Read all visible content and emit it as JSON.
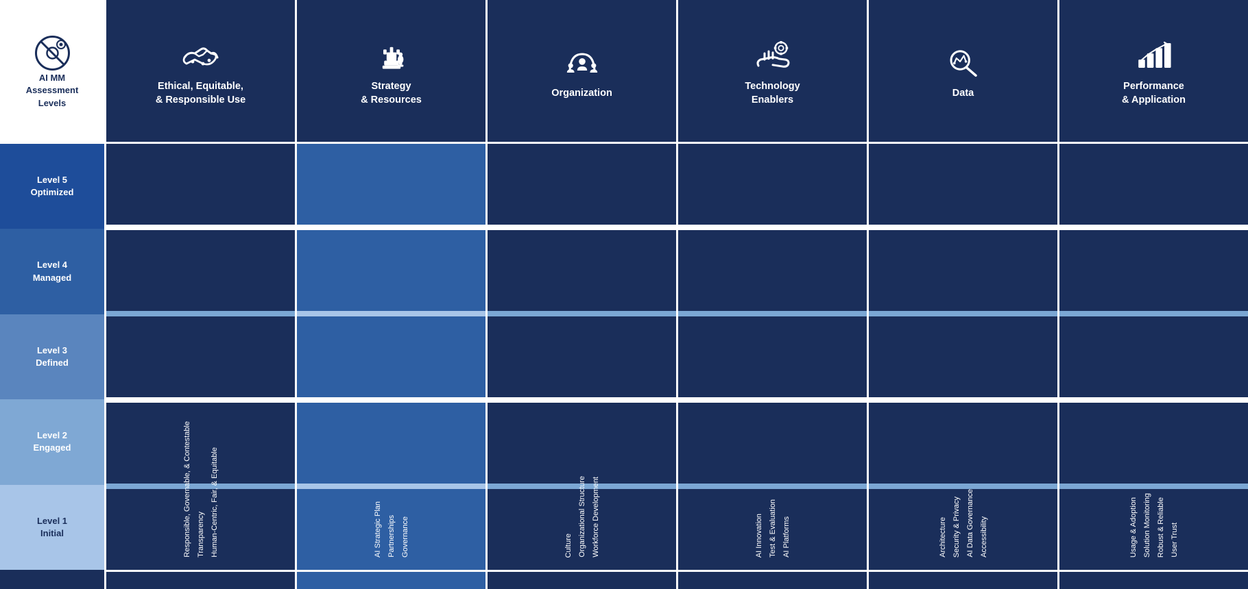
{
  "sidebar": {
    "logo_alt": "AI MM Logo",
    "title": "AI MM\nAssessment\nLevels",
    "levels": [
      {
        "id": "level5",
        "label": "Level 5\nOptimized",
        "color": "#1e4d9a"
      },
      {
        "id": "level4",
        "label": "Level 4\nManaged",
        "color": "#2e5fa3"
      },
      {
        "id": "level3",
        "label": "Level 3\nDefined",
        "color": "#5a85be"
      },
      {
        "id": "level2",
        "label": "Level 2\nEngaged",
        "color": "#7fa8d4"
      },
      {
        "id": "level1",
        "label": "Level 1\nInitial",
        "color": "#a8c5e8"
      }
    ]
  },
  "domains": [
    {
      "id": "ethical",
      "title": "Ethical, Equitable,\n& Responsible Use",
      "icon": "handshake",
      "items": [
        "Responsible, Governable, & Contestable",
        "Transparency",
        "Human-Centric, Fair, & Equitable"
      ],
      "col_shade": "dark"
    },
    {
      "id": "strategy",
      "title": "Strategy\n& Resources",
      "icon": "chess",
      "items": [
        "AI Strategic Plan",
        "Partnerships",
        "Governance"
      ],
      "col_shade": "light"
    },
    {
      "id": "organization",
      "title": "Organization",
      "icon": "org",
      "items": [
        "Culture",
        "Organizational Structure",
        "Workforce Development"
      ],
      "col_shade": "dark"
    },
    {
      "id": "technology",
      "title": "Technology\nEnablers",
      "icon": "gear-hand",
      "items": [
        "AI Innovation",
        "Test & Evaluation",
        "AI Platforms"
      ],
      "col_shade": "dark"
    },
    {
      "id": "data",
      "title": "Data",
      "icon": "data-search",
      "items": [
        "Architecture",
        "Security & Privacy",
        "AI Data Governance",
        "Accessibility"
      ],
      "col_shade": "dark"
    },
    {
      "id": "performance",
      "title": "Performance\n& Application",
      "icon": "chart-up",
      "items": [
        "Usage & Adoption",
        "Solution Monitoring",
        "Robust & Reliable",
        "User Trust"
      ],
      "col_shade": "dark"
    }
  ]
}
